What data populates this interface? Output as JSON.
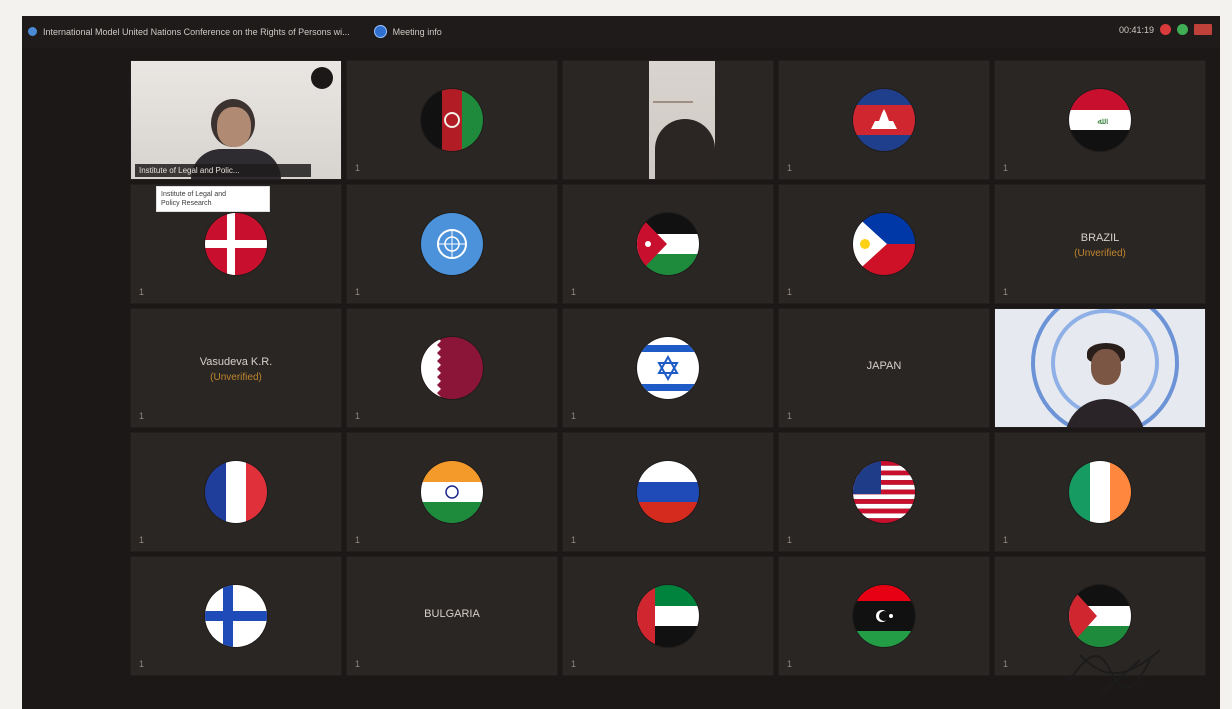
{
  "topbar": {
    "title": "International Model United Nations Conference on the Rights of Persons wi...",
    "meeting_info": "Meeting info",
    "time": "00:41:19"
  },
  "tooltip": {
    "line1": "Institute of Legal and",
    "line2": "Policy Research"
  },
  "tiles": [
    {
      "type": "video",
      "label": "Institute of Legal and Polic...",
      "num": ""
    },
    {
      "type": "flag",
      "flag": "afghanistan-flag",
      "num": "1"
    },
    {
      "type": "video2",
      "num": ""
    },
    {
      "type": "flag",
      "flag": "cambodia-flag",
      "num": "1"
    },
    {
      "type": "flag",
      "flag": "iraq-flag",
      "num": "1"
    },
    {
      "type": "flag",
      "flag": "denmark-flag",
      "num": "1"
    },
    {
      "type": "flag",
      "flag": "united-nations-flag",
      "num": "1"
    },
    {
      "type": "flag",
      "flag": "jordan-flag",
      "num": "1"
    },
    {
      "type": "flag",
      "flag": "philippines-flag",
      "num": "1"
    },
    {
      "type": "name",
      "name": "BRAZIL",
      "sub": "(Unverified)",
      "num": "1"
    },
    {
      "type": "name",
      "name": "Vasudeva K.R.",
      "sub": "(Unverified)",
      "num": "1"
    },
    {
      "type": "flag",
      "flag": "qatar-flag",
      "num": "1"
    },
    {
      "type": "flag",
      "flag": "israel-flag",
      "num": "1"
    },
    {
      "type": "name",
      "name": "JAPAN",
      "sub": "",
      "num": "1"
    },
    {
      "type": "video3",
      "num": ""
    },
    {
      "type": "flag",
      "flag": "france-flag",
      "num": "1"
    },
    {
      "type": "flag",
      "flag": "india-flag",
      "num": "1"
    },
    {
      "type": "flag",
      "flag": "russia-flag",
      "num": "1"
    },
    {
      "type": "flag",
      "flag": "usa-flag",
      "num": "1"
    },
    {
      "type": "flag",
      "flag": "ireland-flag",
      "num": "1"
    },
    {
      "type": "flag",
      "flag": "finland-flag",
      "num": "1"
    },
    {
      "type": "name",
      "name": "BULGARIA",
      "sub": "",
      "num": "1"
    },
    {
      "type": "flag",
      "flag": "uae-flag",
      "num": "1"
    },
    {
      "type": "flag",
      "flag": "libya-flag",
      "num": "1"
    },
    {
      "type": "flag",
      "flag": "palestine-flag",
      "num": "1"
    }
  ],
  "colors": {
    "tile_bg": "#2a2624",
    "accent_unverified": "#c0862e",
    "record_red": "#d93a3a"
  }
}
